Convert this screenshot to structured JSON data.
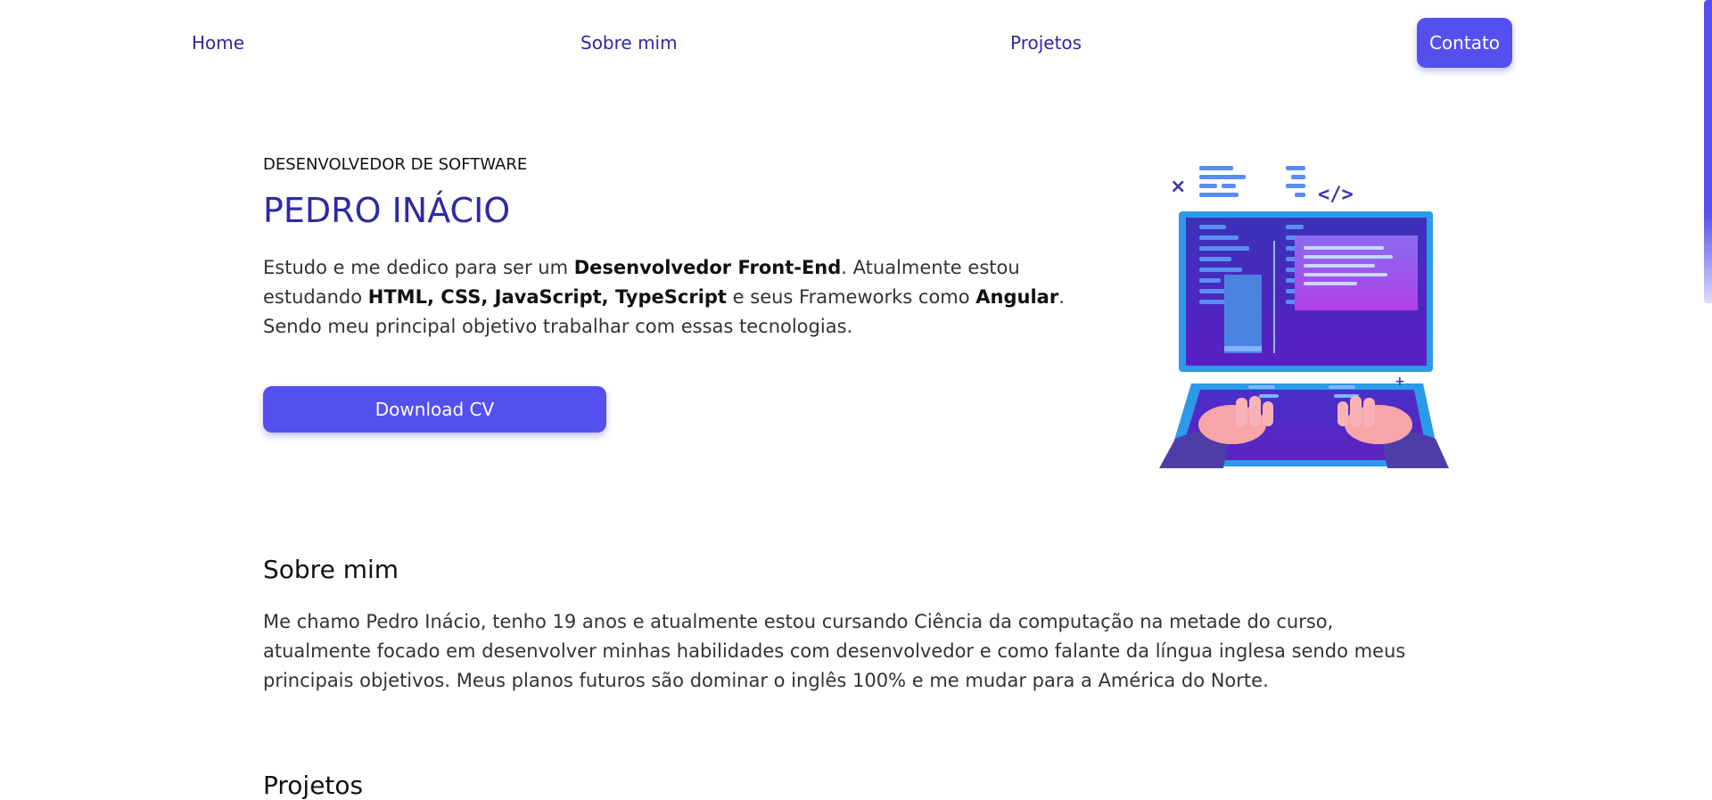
{
  "nav": {
    "home": "Home",
    "about": "Sobre mim",
    "projects": "Projetos",
    "contact": "Contato"
  },
  "hero": {
    "eyebrow": "DESENVOLVEDOR DE SOFTWARE",
    "name": "PEDRO INÁCIO",
    "desc": {
      "p1": "Estudo e me dedico para ser um ",
      "b1": "Desenvolvedor Front-End",
      "p2": ". Atualmente estou estudando ",
      "b2": "HTML, CSS, JavaScript, TypeScript",
      "p3": " e seus Frameworks como ",
      "b3": "Angular",
      "p4": ". Sendo meu principal objetivo trabalhar com essas tecnologias."
    },
    "cta": "Download CV",
    "illustration_icon": "developer-laptop-illustration"
  },
  "about": {
    "title": "Sobre mim",
    "text": "Me chamo Pedro Inácio, tenho 19 anos e atualmente estou cursando Ciência da computação na metade do curso, atualmente focado em desenvolver minhas habilidades com desenvolvedor e como falante da língua inglesa sendo meus principais objetivos. Meus planos futuros são dominar o inglês 100% e me mudar para a América do Norte."
  },
  "projects": {
    "title": "Projetos"
  },
  "colors": {
    "accent": "#5350ef",
    "heading": "#2e2aa3"
  }
}
